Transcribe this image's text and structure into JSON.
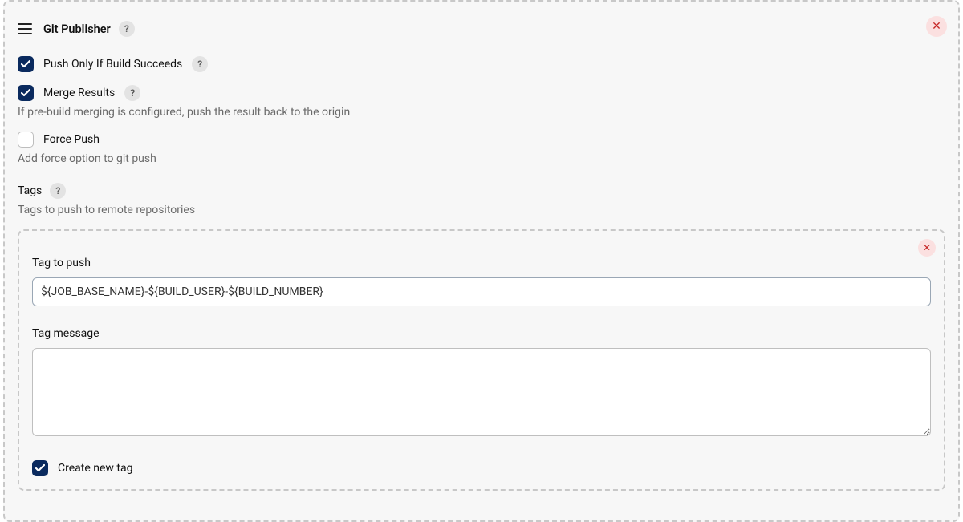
{
  "panel": {
    "title": "Git Publisher",
    "help": "?",
    "close_glyph": "✕"
  },
  "options": {
    "push_only_if_build_succeeds": {
      "label": "Push Only If Build Succeeds",
      "checked": true,
      "help": "?"
    },
    "merge_results": {
      "label": "Merge Results",
      "checked": true,
      "help": "?",
      "description": "If pre-build merging is configured, push the result back to the origin"
    },
    "force_push": {
      "label": "Force Push",
      "checked": false,
      "description": "Add force option to git push"
    }
  },
  "tags_section": {
    "label": "Tags",
    "help": "?",
    "description": "Tags to push to remote repositories"
  },
  "tag_entry": {
    "close_glyph": "✕",
    "tag_to_push": {
      "label": "Tag to push",
      "value": "${JOB_BASE_NAME}-${BUILD_USER}-${BUILD_NUMBER}"
    },
    "tag_message": {
      "label": "Tag message",
      "value": ""
    },
    "create_new_tag": {
      "label": "Create new tag",
      "checked": true
    }
  }
}
